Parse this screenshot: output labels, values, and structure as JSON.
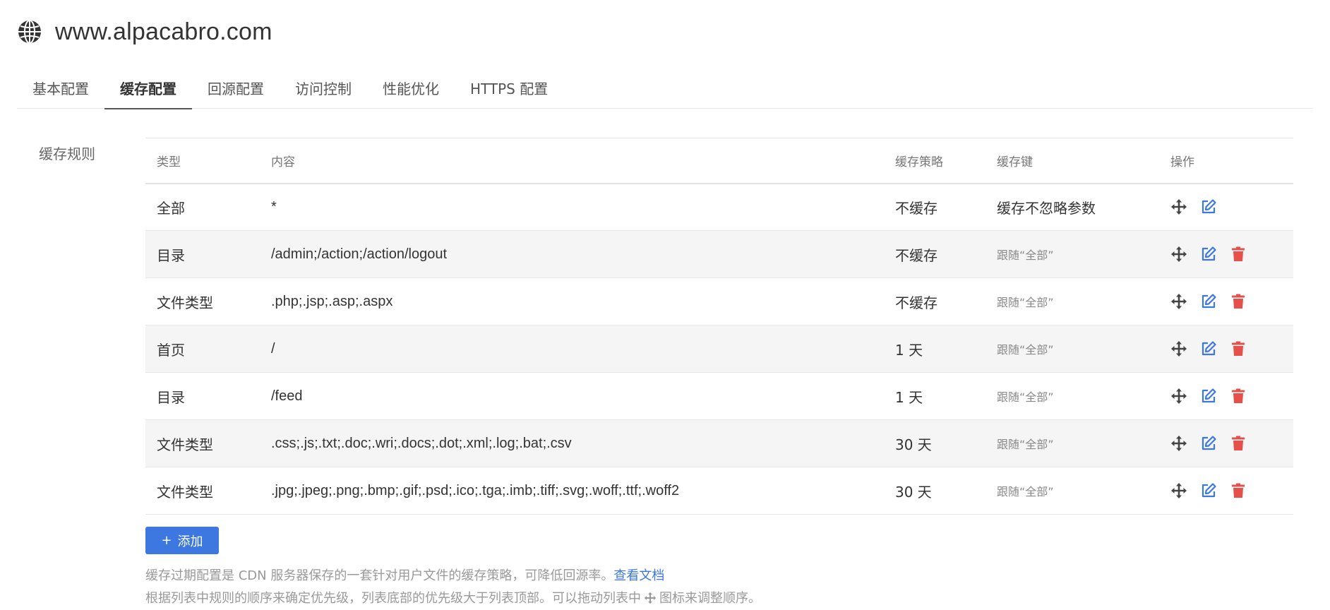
{
  "site": {
    "title": "www.alpacabro.com"
  },
  "tabs": [
    {
      "label": "基本配置",
      "active": false
    },
    {
      "label": "缓存配置",
      "active": true
    },
    {
      "label": "回源配置",
      "active": false
    },
    {
      "label": "访问控制",
      "active": false
    },
    {
      "label": "性能优化",
      "active": false
    },
    {
      "label": "HTTPS 配置",
      "active": false
    }
  ],
  "section": {
    "label": "缓存规则"
  },
  "table": {
    "headers": {
      "type": "类型",
      "content": "内容",
      "policy": "缓存策略",
      "key": "缓存键",
      "ops": "操作"
    },
    "rows": [
      {
        "type": "全部",
        "content": "*",
        "policy": "不缓存",
        "key": "缓存不忽略参数",
        "deletable": false
      },
      {
        "type": "目录",
        "content": "/admin;/action;/action/logout",
        "policy": "不缓存",
        "key": "跟随“全部”",
        "deletable": true
      },
      {
        "type": "文件类型",
        "content": ".php;.jsp;.asp;.aspx",
        "policy": "不缓存",
        "key": "跟随“全部”",
        "deletable": true
      },
      {
        "type": "首页",
        "content": "/",
        "policy": "1 天",
        "key": "跟随“全部”",
        "deletable": true
      },
      {
        "type": "目录",
        "content": "/feed",
        "policy": "1 天",
        "key": "跟随“全部”",
        "deletable": true
      },
      {
        "type": "文件类型",
        "content": ".css;.js;.txt;.doc;.wri;.docs;.dot;.xml;.log;.bat;.csv",
        "policy": "30 天",
        "key": "跟随“全部”",
        "deletable": true
      },
      {
        "type": "文件类型",
        "content": ".jpg;.jpeg;.png;.bmp;.gif;.psd;.ico;.tga;.imb;.tiff;.svg;.woff;.ttf;.woff2",
        "policy": "30 天",
        "key": "跟随“全部”",
        "deletable": true
      }
    ]
  },
  "actions": {
    "add_label": "添加"
  },
  "notes": {
    "line1": "缓存过期配置是 CDN 服务器保存的一套针对用户文件的缓存策略，可降低回源率。",
    "doc_link": "查看文档",
    "line2_before": "根据列表中规则的顺序来确定优先级，列表底部的优先级大于列表顶部。可以拖动列表中",
    "line2_after": "图标来调整顺序。"
  },
  "colors": {
    "accent": "#3d77e0",
    "danger": "#e5504a",
    "icon_dark": "#444444"
  }
}
